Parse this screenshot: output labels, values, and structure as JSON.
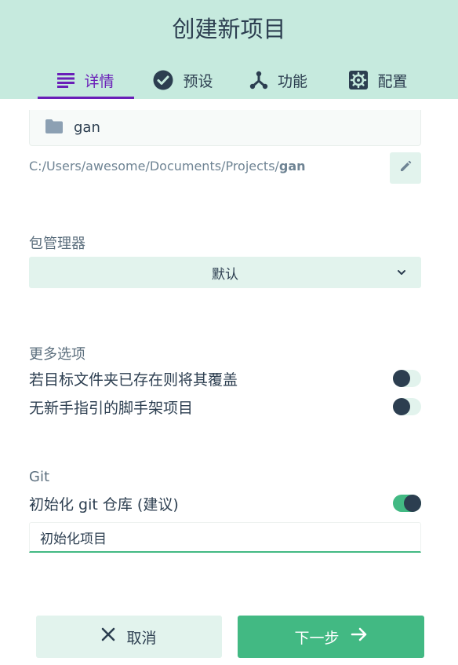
{
  "header": {
    "title": "创建新项目",
    "tabs": [
      {
        "label": "详情",
        "icon": "list-icon",
        "active": true
      },
      {
        "label": "预设",
        "icon": "check-circle-icon",
        "active": false
      },
      {
        "label": "功能",
        "icon": "branch-icon",
        "active": false
      },
      {
        "label": "配置",
        "icon": "gear-icon",
        "active": false
      }
    ]
  },
  "folder": {
    "name": "gan",
    "icon": "folder-icon",
    "path_prefix": "C:/Users/awesome/Documents/Projects/",
    "path_folder": "gan",
    "edit_icon": "pencil-icon"
  },
  "package_manager": {
    "label": "包管理器",
    "selected": "默认",
    "icon": "chevron-down-icon"
  },
  "more_options": {
    "label": "更多选项",
    "items": [
      {
        "label": "若目标文件夹已存在则将其覆盖",
        "enabled": false
      },
      {
        "label": "无新手指引的脚手架项目",
        "enabled": false
      }
    ]
  },
  "git": {
    "label": "Git",
    "init_label": "初始化 git 仓库 (建议)",
    "init_enabled": true,
    "commit_message": "初始化项目"
  },
  "actions": {
    "cancel_label": "取消",
    "cancel_icon": "close-icon",
    "next_label": "下一步",
    "next_icon": "arrow-right-icon"
  },
  "colors": {
    "header_bg": "#c6eade",
    "accent_purple": "#6a1fb8",
    "accent_green": "#42b983",
    "text_dark": "#2c3e50",
    "light_green_bg": "#e2f3ed"
  }
}
